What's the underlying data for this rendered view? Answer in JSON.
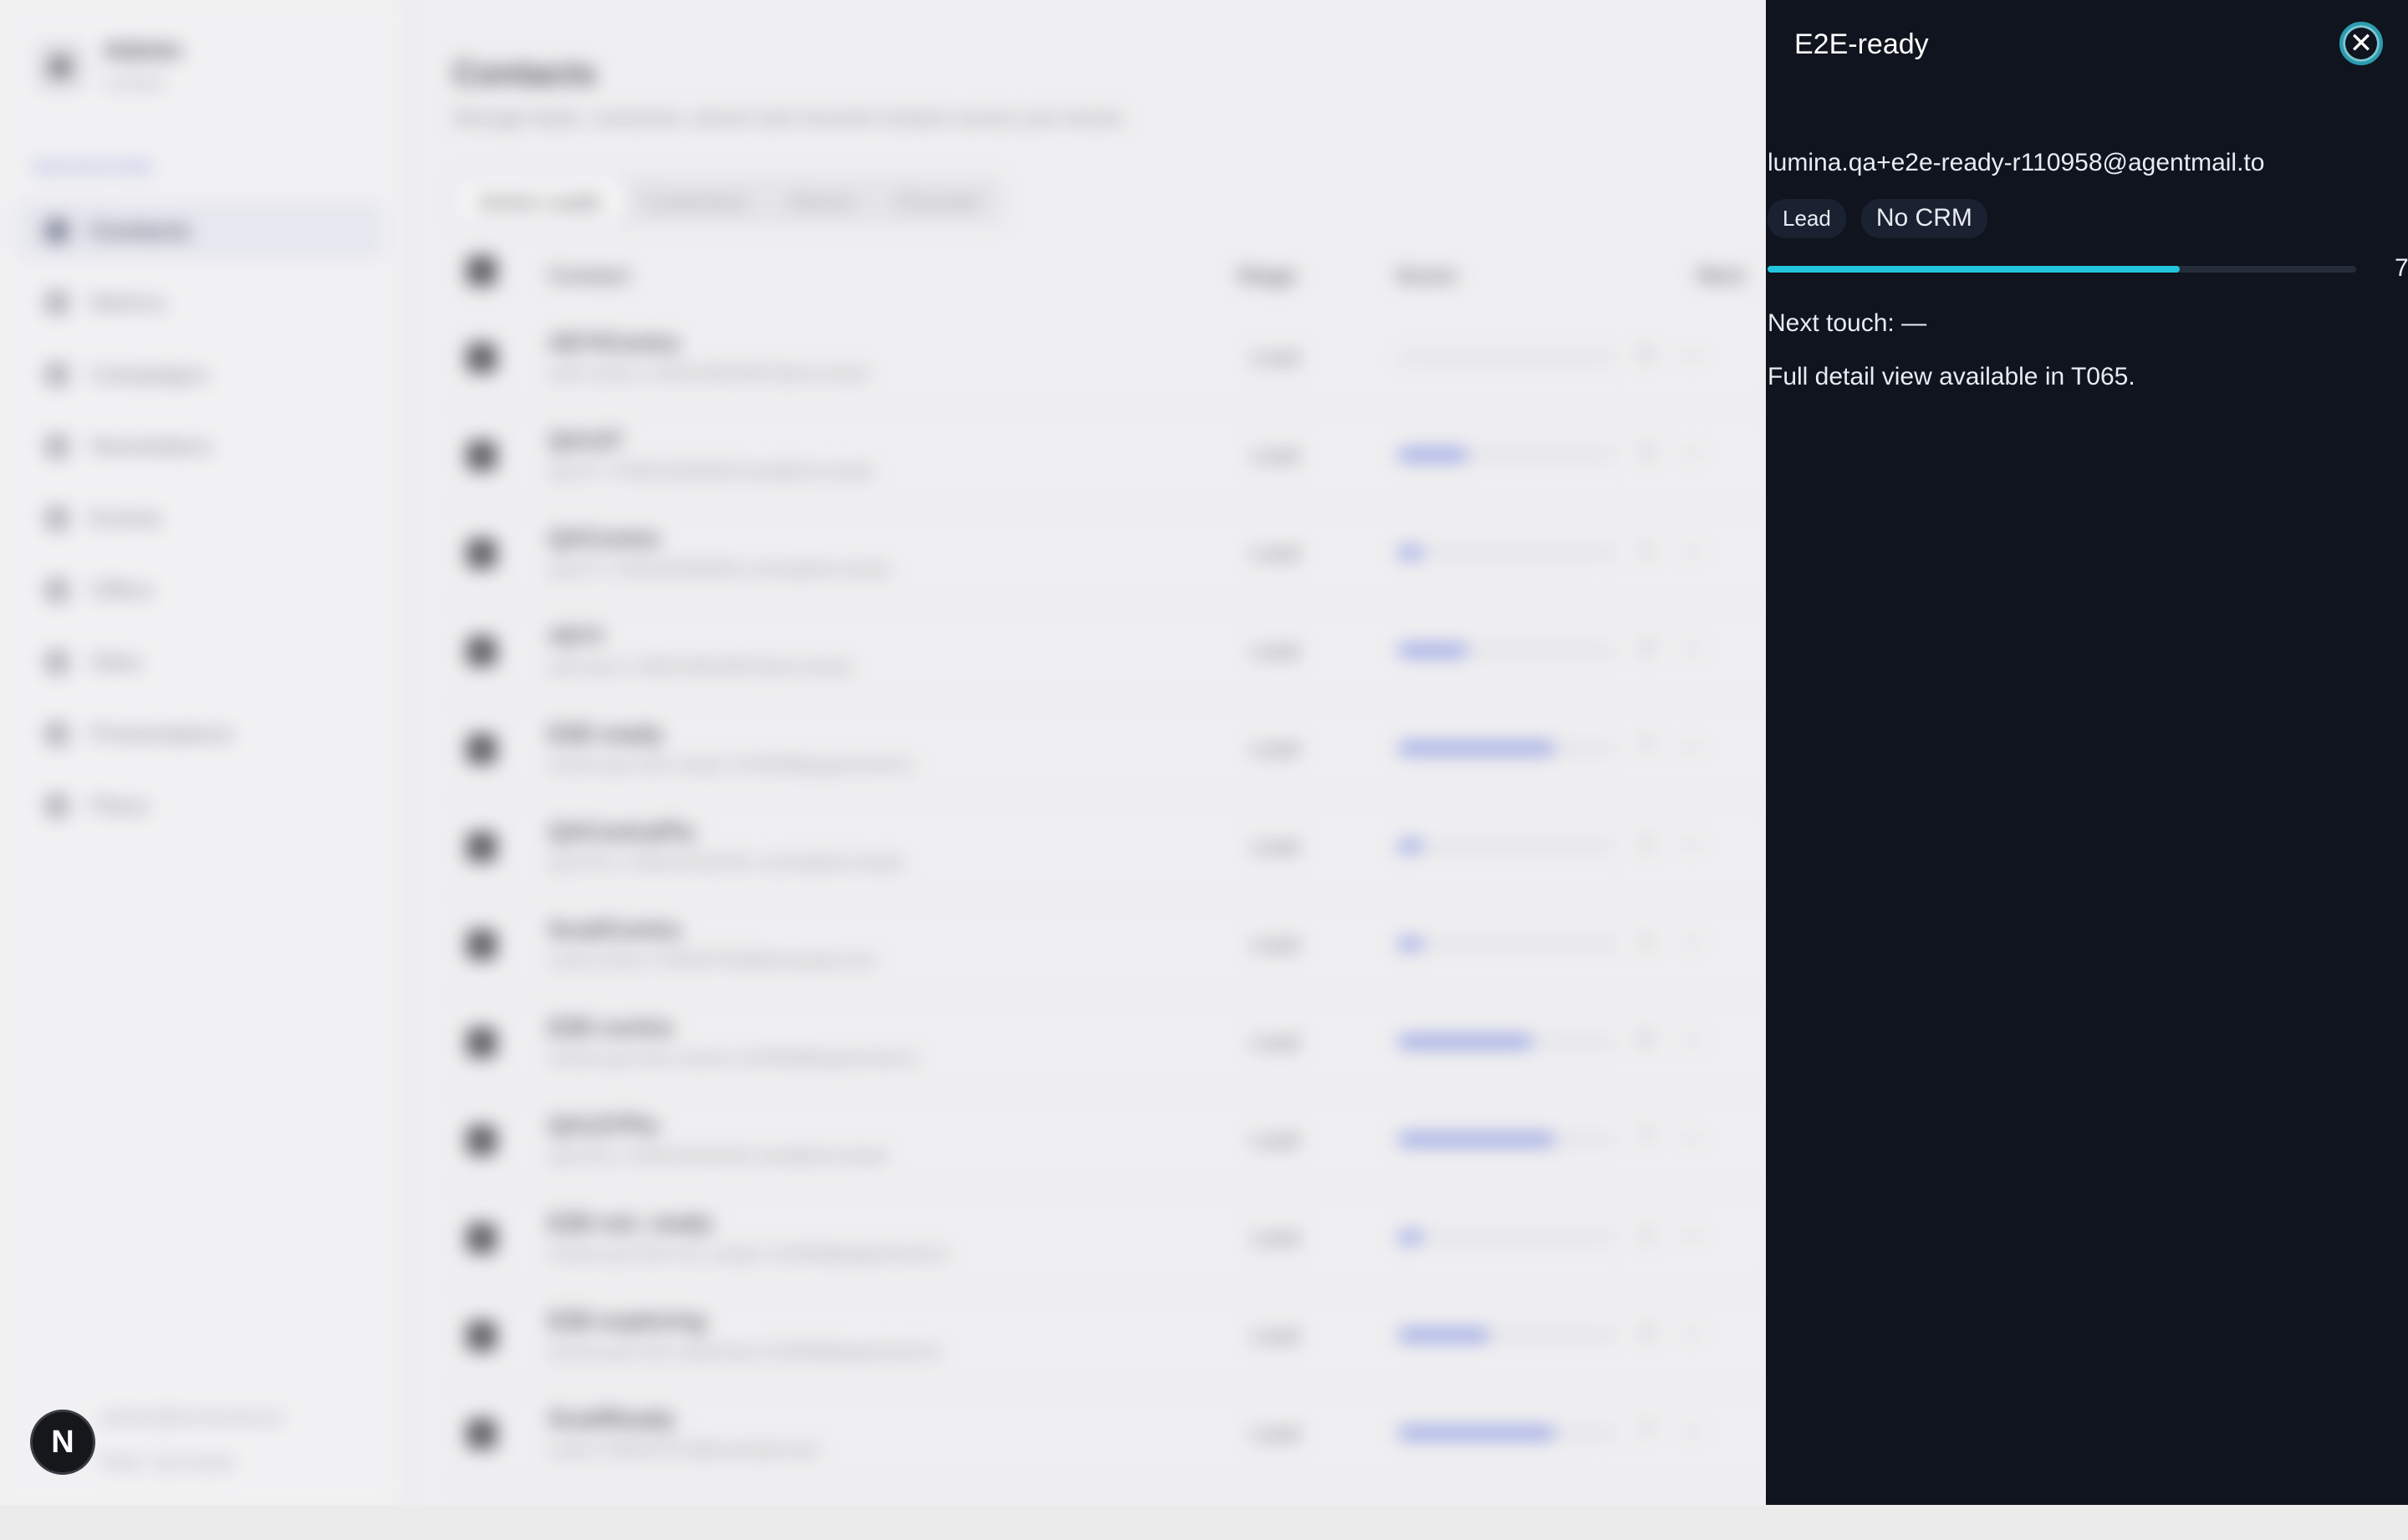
{
  "sidebar": {
    "org_name": "Admin",
    "org_sub": "Lumina",
    "nav_heading": "NAVIGATION",
    "items": [
      {
        "label": "Contacts",
        "icon": "contacts-icon",
        "active": true
      },
      {
        "label": "Metrics",
        "icon": "metrics-icon"
      },
      {
        "label": "Campaigns",
        "icon": "campaigns-icon"
      },
      {
        "label": "Newsletters",
        "icon": "newsletters-icon"
      },
      {
        "label": "Events",
        "icon": "calendar-icon"
      },
      {
        "label": "Offers",
        "icon": "offers-icon"
      },
      {
        "label": "Sites",
        "icon": "globe-icon"
      },
      {
        "label": "Presentations",
        "icon": "presentations-icon"
      },
      {
        "label": "Plans",
        "icon": "plans-icon"
      }
    ],
    "footer_email": "admin@luminacloud",
    "footer_status": "Role: QA tester"
  },
  "main": {
    "title": "Contacts",
    "subtitle": "Manage leads, customers, alumni and churned contacts across your tenant.",
    "tabs": [
      {
        "label": "Active Leads",
        "active": true
      },
      {
        "label": "Customers"
      },
      {
        "label": "Alumni"
      },
      {
        "label": "Churned"
      }
    ],
    "columns": [
      "Contact",
      "Stage",
      "Score",
      "Next"
    ],
    "rows": [
      {
        "name": "AEYIContra",
        "email": "ae9-contra-1780019604987@ckv.leads",
        "stage": "Lead",
        "score": 0,
        "progress": 0.0,
        "next": "—"
      },
      {
        "name": "QA137",
        "email": "qa137-1780019409050-lead@ckv.leads",
        "stage": "Lead",
        "score": 3,
        "progress": 0.32,
        "next": "—"
      },
      {
        "name": "QAContra",
        "email": "qa137-1780019409050-contra@ckv.leads",
        "stage": "Lead",
        "score": 1,
        "progress": 0.11,
        "next": "—"
      },
      {
        "name": "AEYI",
        "email": "ae9-aeyi-1780019604987@ckv.leads",
        "stage": "Lead",
        "score": 3,
        "progress": 0.32,
        "next": "—"
      },
      {
        "name": "E2E-ready",
        "email": "lumina.qa+e2e-ready-r110958@agentmail.to",
        "stage": "Lead",
        "score": 7,
        "progress": 0.72,
        "next": "—"
      },
      {
        "name": "QAContraPlu",
        "email": "qa137lu-1780019332261-contra@ckv.leads",
        "stage": "Lead",
        "score": 1,
        "progress": 0.11,
        "next": "—"
      },
      {
        "name": "ScaitContra",
        "email": "scait-contra-1780037548@example.test",
        "stage": "Lead",
        "score": 1,
        "progress": 0.11,
        "next": "—"
      },
      {
        "name": "E2E-contra",
        "email": "lumina.qa+e2e-contra-r110958@agentmail.to",
        "stage": "Lead",
        "score": 6,
        "progress": 0.62,
        "next": "—"
      },
      {
        "name": "QA137Plu",
        "email": "qa137lu-1780019332261-lead@ckv.leads",
        "stage": "Lead",
        "score": 7,
        "progress": 0.72,
        "next": "—"
      },
      {
        "name": "E2E-not_ready",
        "email": "lumina.qa+e2e-not_ready-r110958@agentmail.to",
        "stage": "Lead",
        "score": 1,
        "progress": 0.11,
        "next": "—"
      },
      {
        "name": "E2E-exploring",
        "email": "lumina.qa+e2e-exploring-r110958@agentmail.to",
        "stage": "Lead",
        "score": 4,
        "progress": 0.42,
        "next": "—"
      },
      {
        "name": "ScaitReady",
        "email": "scait-1780037574@example.test",
        "stage": "Lead",
        "score": 7,
        "progress": 0.72,
        "next": "—"
      }
    ]
  },
  "fab": {
    "label": "N"
  },
  "panel": {
    "title": "E2E-ready",
    "close_label": "✕",
    "email": "lumina.qa+e2e-ready-r110958@agentmail.to",
    "badges": [
      "Lead",
      "No CRM"
    ],
    "score": "7",
    "score_progress": 0.7,
    "next_touch": "Next touch: —",
    "note": "Full detail view available in T065."
  },
  "colors": {
    "panel_bg": "#0f141e",
    "accent": "#22c4dc",
    "score_bar": "#6b7de0"
  }
}
